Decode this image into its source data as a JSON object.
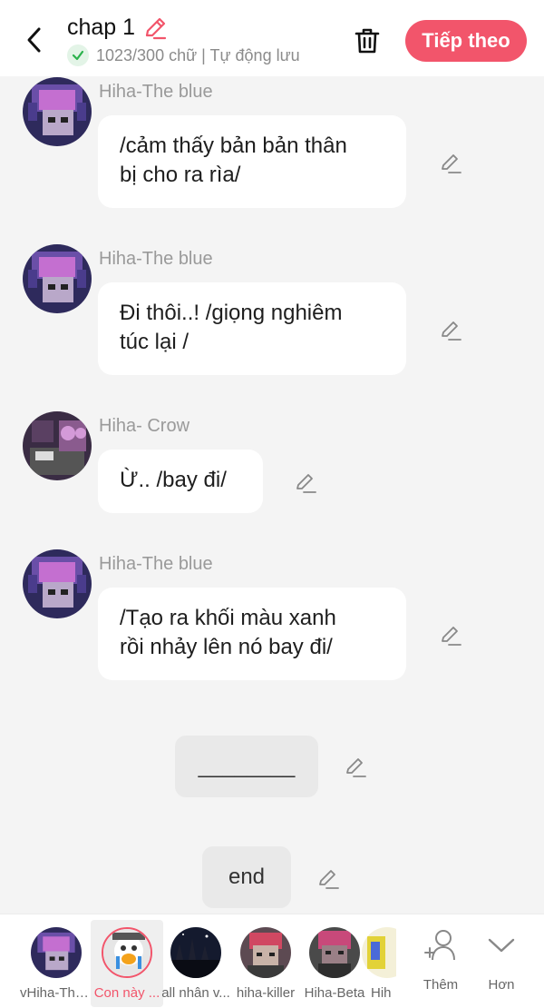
{
  "header": {
    "title": "chap 1",
    "subtitle": "1023/300 chữ | Tự động lưu",
    "next_label": "Tiếp theo"
  },
  "messages": [
    {
      "sender": "Hiha-The blue",
      "text_lines": [
        "/cảm thấy bản bản thân",
        "bị cho ra rìa/"
      ]
    },
    {
      "sender": "Hiha-The blue",
      "text_lines": [
        "Đi thôi..! /giọng nghiêm",
        "túc lại /"
      ]
    },
    {
      "sender": "Hiha- Crow",
      "text_lines": [
        "Ừ.. /bay đi/"
      ]
    },
    {
      "sender": "Hiha-The blue",
      "text_lines": [
        "/Tạo ra khối màu xanh",
        "rồi nhảy lên nó bay đi/"
      ]
    }
  ],
  "narration": [
    {
      "text": "________"
    },
    {
      "text": "end"
    }
  ],
  "characters": [
    {
      "name": "vHiha-The ..."
    },
    {
      "name": "Con này ..."
    },
    {
      "name": "all nhân v..."
    },
    {
      "name": "hiha-killer"
    },
    {
      "name": "Hiha-Beta"
    },
    {
      "name": "Hih"
    }
  ],
  "tools": {
    "add_label": "Thêm",
    "more_label": "Hơn"
  },
  "colors": {
    "accent": "#f2556b",
    "check": "#2bb24c"
  }
}
